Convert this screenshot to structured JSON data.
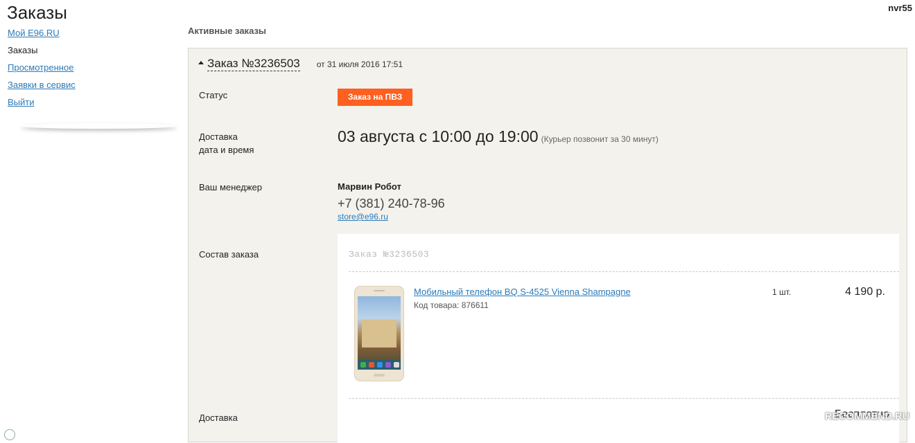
{
  "page": {
    "title": "Заказы",
    "username": "nvr55"
  },
  "sidebar": {
    "items": [
      {
        "label": "Мой E96.RU",
        "current": false
      },
      {
        "label": "Заказы",
        "current": true
      },
      {
        "label": "Просмотренное",
        "current": false
      },
      {
        "label": "Заявки в сервис",
        "current": false
      },
      {
        "label": "Выйти",
        "current": false
      }
    ]
  },
  "main": {
    "section_title": "Активные заказы",
    "order": {
      "number": "Заказ №3236503",
      "date": "от 31 июля 2016 17:51",
      "status_label": "Статус",
      "status": "Заказ на ПВЗ",
      "status_color": "#ff5f1f",
      "delivery_label": "Доставка",
      "delivery_label_2": "дата и время",
      "delivery_datetime": "03 августа с 10:00 до 19:00",
      "courier_note": "(Курьер позвонит за 30 минут)",
      "manager_label": "Ваш менеджер",
      "manager_name": "Марвин Робот",
      "manager_phone": "+7 (381) 240-78-96",
      "manager_email": "store@e96.ru",
      "contents_label": "Состав заказа",
      "contents_title": "Заказ №3236503",
      "items": [
        {
          "name": "Мобильный телефон BQ S-4525 Vienna Shampagne",
          "code": "Код товара: 876611",
          "qty": "1 шт.",
          "price": "4 190 р.",
          "image_icon": "phone-product-image"
        }
      ],
      "shipping_label": "Доставка",
      "shipping_cost": "Бесплатно"
    }
  },
  "watermark": "RECOMMEND.RU"
}
